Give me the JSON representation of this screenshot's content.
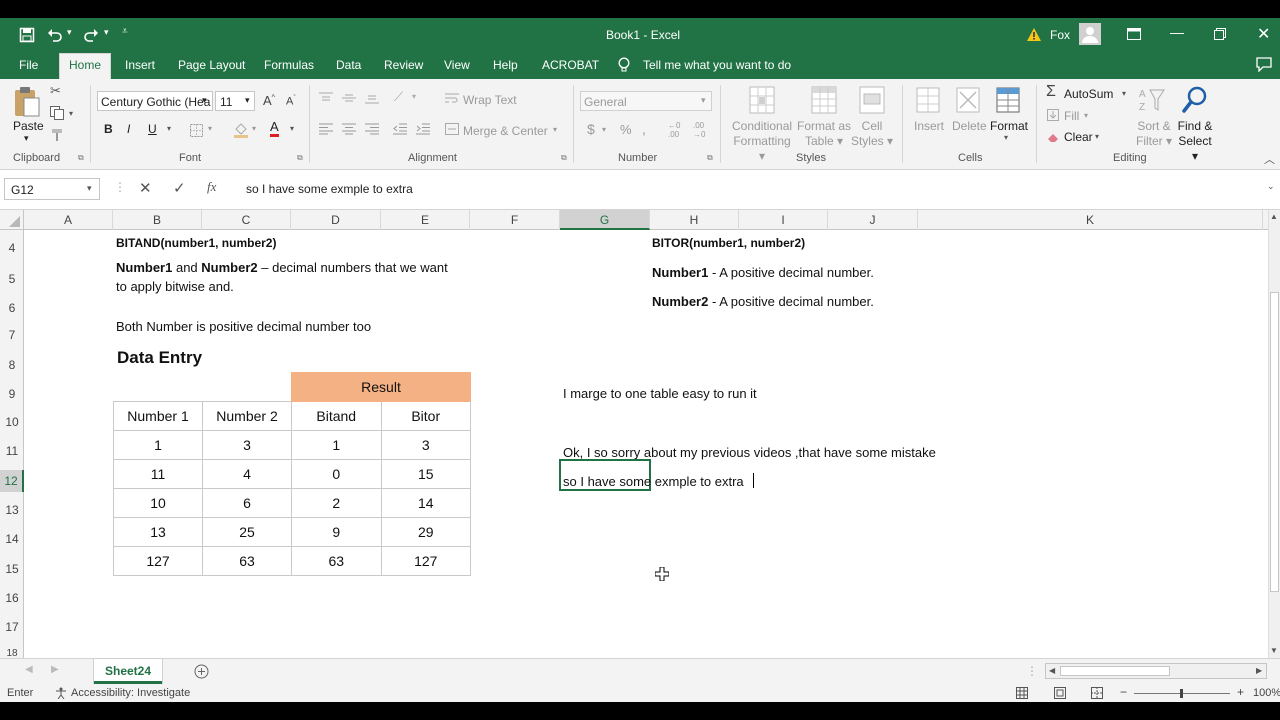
{
  "window": {
    "title": "Book1  -  Excel",
    "user": "Fox"
  },
  "tabs": [
    "File",
    "Home",
    "Insert",
    "Page Layout",
    "Formulas",
    "Data",
    "Review",
    "View",
    "Help",
    "ACROBAT"
  ],
  "tell_me": "Tell me what you want to do",
  "ribbon": {
    "paste": "Paste",
    "font_name": "Century Gothic (Hea",
    "font_size": "11",
    "wrap_text": "Wrap Text",
    "merge_center": "Merge & Center",
    "number_format": "General",
    "conditional": [
      "Conditional",
      "Formatting"
    ],
    "format_table": [
      "Format as",
      "Table"
    ],
    "cell_styles": [
      "Cell",
      "Styles"
    ],
    "insert": "Insert",
    "delete": "Delete",
    "format": "Format",
    "autosum": "AutoSum",
    "fill": "Fill",
    "clear": "Clear",
    "sort_filter": [
      "Sort &",
      "Filter"
    ],
    "find_select": [
      "Find &",
      "Select"
    ],
    "groups": [
      "Clipboard",
      "Font",
      "Alignment",
      "Number",
      "Styles",
      "Cells",
      "Editing"
    ]
  },
  "formula_bar": {
    "name_box": "G12",
    "content": "so I have some exmple to extra"
  },
  "columns": [
    "A",
    "B",
    "C",
    "D",
    "E",
    "F",
    "G",
    "H",
    "I",
    "J",
    "K"
  ],
  "rows": [
    "4",
    "5",
    "6",
    "7",
    "8",
    "9",
    "10",
    "11",
    "12",
    "13",
    "14",
    "15",
    "16",
    "17",
    "18"
  ],
  "sheet": {
    "b4": "BITAND(number1, number2)",
    "b5_bold1": "Number1",
    "b5_and": " and ",
    "b5_bold2": "Number2",
    "b5_rest": " – decimal numbers that we want",
    "b5_line2": "to apply bitwise and.",
    "b7": "Both Number is positive decimal number too",
    "b8": "Data Entry",
    "g4": "BITOR(number1, number2)",
    "g5_bold": "Number1",
    "g5_rest": " - A positive decimal number.",
    "g6_bold": "Number2",
    "g6_rest": " - A positive decimal number.",
    "g9": "I marge to one table easy to run it",
    "g11": "Ok, I so sorry about my previous videos ,that have some mistake",
    "g12": "so I have some exmple to extra"
  },
  "table": {
    "result_header": "Result",
    "headers": [
      "Number 1",
      "Number 2",
      "Bitand",
      "Bitor"
    ],
    "rows": [
      [
        "1",
        "3",
        "1",
        "3"
      ],
      [
        "11",
        "4",
        "0",
        "15"
      ],
      [
        "10",
        "6",
        "2",
        "14"
      ],
      [
        "13",
        "25",
        "9",
        "29"
      ],
      [
        "127",
        "63",
        "63",
        "127"
      ]
    ]
  },
  "sheet_tab": "Sheet24",
  "status": {
    "mode": "Enter",
    "accessibility": "Accessibility: Investigate",
    "zoom": "100%"
  },
  "colors": {
    "excel_green": "#217346",
    "result_fill": "#f4b183"
  }
}
